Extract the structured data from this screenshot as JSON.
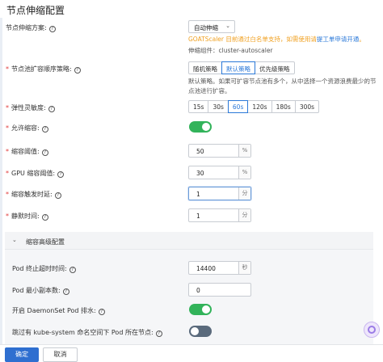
{
  "header": {
    "title": "节点伸缩配置"
  },
  "scale_plan": {
    "label": "节点伸缩方案:",
    "value": "自动伸缩",
    "warning": "GOATScaler 目前通过白名单支持，如需使用请提工单申请开通。",
    "warning_link": "提工单申请开通",
    "component": "伸缩组件：cluster-autoscaler"
  },
  "scaling_strategy": {
    "label": "节点池扩容顺序策略:",
    "options": [
      "随机策略",
      "默认策略",
      "优先级策略"
    ],
    "active_index": 1,
    "description": "默认策略。如果可扩容节点池有多个，从中选择一个资源浪费最少的节点池进行扩容。"
  },
  "elasticity": {
    "label": "弹性灵敏度:",
    "options": [
      "15s",
      "30s",
      "60s",
      "120s",
      "180s",
      "300s"
    ],
    "active_index": 2
  },
  "allow_scale_down": {
    "label": "允许缩容:",
    "enabled": true
  },
  "scale_down_threshold": {
    "label": "缩容阈值:",
    "value": "50",
    "unit": "%"
  },
  "gpu_threshold": {
    "label": "GPU 缩容阈值:",
    "value": "30",
    "unit": "%"
  },
  "scale_down_delay": {
    "label": "缩容触发时延:",
    "value": "1",
    "unit": "分"
  },
  "silent_time": {
    "label": "静默时间:",
    "value": "1",
    "unit": "分"
  },
  "advanced": {
    "title": "缩容高级配置",
    "pod_termination": {
      "label": "Pod 终止超时时间:",
      "value": "14400",
      "unit": "秒"
    },
    "pod_min_replicas": {
      "label": "Pod 最小副本数:",
      "value": "0"
    },
    "daemonset_evict": {
      "label": "开启 DaemonSet Pod 排水:",
      "enabled": true
    },
    "skip_kube_system": {
      "label": "跳过有 kube-system 命名空间下 Pod 所在节点:",
      "enabled": false
    }
  },
  "footer": {
    "confirm": "确定",
    "cancel": "取消"
  },
  "colors": {
    "primary": "#2f6fd0",
    "toggle_on": "#32b35a",
    "toggle_off": "#5a6a7c",
    "warning": "#f0a020",
    "required": "#e23b3b"
  }
}
